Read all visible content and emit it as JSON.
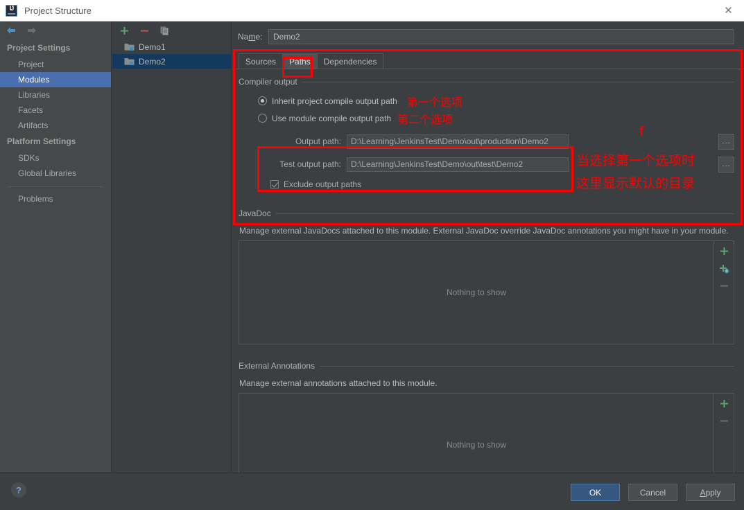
{
  "window": {
    "title": "Project Structure",
    "app_icon": "intellij-idea-icon",
    "close_label": "✕"
  },
  "sidebar": {
    "back_icon": "arrow-left-icon",
    "forward_icon": "arrow-right-icon",
    "groups": [
      {
        "heading": "Project Settings",
        "items": [
          {
            "label": "Project",
            "selected": false
          },
          {
            "label": "Modules",
            "selected": true
          },
          {
            "label": "Libraries",
            "selected": false
          },
          {
            "label": "Facets",
            "selected": false
          },
          {
            "label": "Artifacts",
            "selected": false
          }
        ]
      },
      {
        "heading": "Platform Settings",
        "items": [
          {
            "label": "SDKs",
            "selected": false
          },
          {
            "label": "Global Libraries",
            "selected": false
          }
        ]
      }
    ],
    "problems_label": "Problems"
  },
  "modules": {
    "toolbar": {
      "add_icon": "plus-icon",
      "remove_icon": "minus-icon",
      "copy_icon": "copy-icon"
    },
    "items": [
      {
        "label": "Demo1",
        "selected": false
      },
      {
        "label": "Demo2",
        "selected": true
      }
    ]
  },
  "main": {
    "name_label": "Na",
    "name_label_underlined": "m",
    "name_label_rest": "e:",
    "name_value": "Demo2",
    "tabs": [
      {
        "label": "Sources",
        "active": false
      },
      {
        "label": "Paths",
        "active": true
      },
      {
        "label": "Dependencies",
        "active": false
      }
    ],
    "compiler_output": {
      "group_label": "Compiler output",
      "radios": [
        {
          "label": "Inherit project compile output path",
          "checked": true
        },
        {
          "label": "Use module compile output path",
          "checked": false
        }
      ],
      "output_path": {
        "label": "Output path:",
        "value": "D:\\Learning\\JenkinsTest\\Demo\\out\\production\\Demo2",
        "browse_label": "..."
      },
      "test_output_path": {
        "label": "Test output path:",
        "value": "D:\\Learning\\JenkinsTest\\Demo\\out\\test\\Demo2",
        "browse_label": "..."
      },
      "exclude_checkbox": {
        "label": "Exclude output paths",
        "checked": true
      }
    },
    "javadoc": {
      "group_label": "JavaDoc",
      "description": "Manage external JavaDocs attached to this module. External JavaDoc override JavaDoc annotations you might have in your module.",
      "empty_text": "Nothing to show",
      "add_icon": "plus-icon",
      "add_url_icon": "plus-globe-icon",
      "remove_icon": "minus-icon"
    },
    "external_annotations": {
      "group_label": "External Annotations",
      "description": "Manage external annotations attached to this module.",
      "empty_text": "Nothing to show",
      "add_icon": "plus-icon",
      "remove_icon": "minus-icon"
    }
  },
  "annotations": {
    "first_option": "第一个选项",
    "second_option": "第二个选项",
    "stray_f": "f",
    "when_first_selected": "当选择第一个选项时",
    "default_dir_shown": "这里显示默认的目录",
    "color": "#ff0000"
  },
  "footer": {
    "help_label": "?",
    "buttons": [
      {
        "label": "OK",
        "primary": true
      },
      {
        "label": "Cancel",
        "primary": false
      },
      {
        "label": "Apply",
        "primary": false,
        "mnemonic": "A"
      }
    ]
  }
}
